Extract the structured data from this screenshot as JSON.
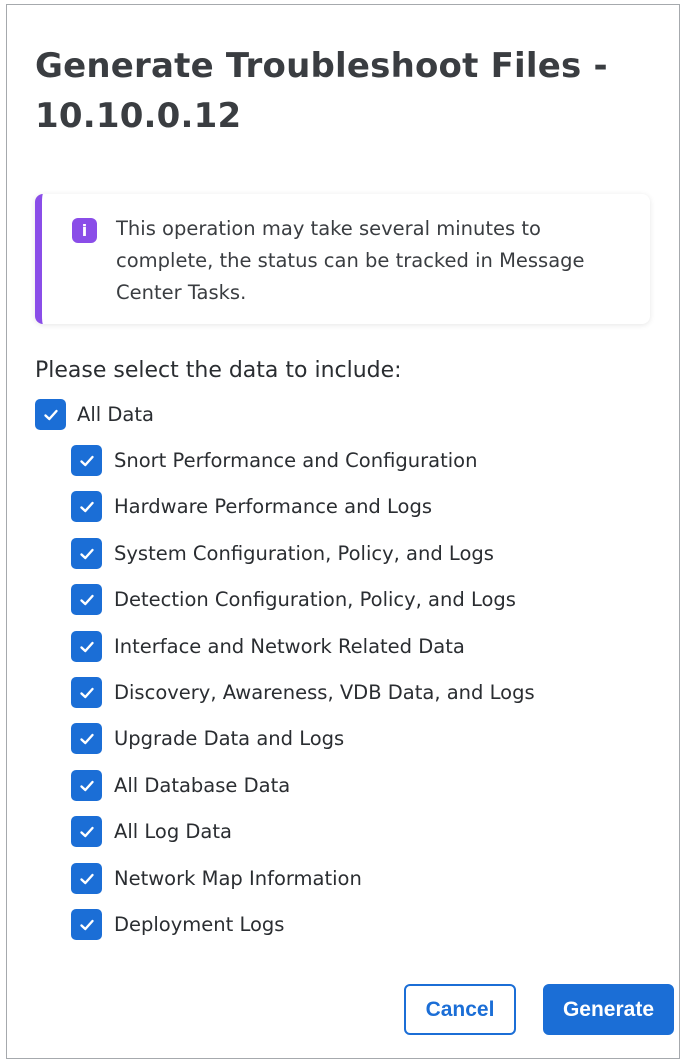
{
  "dialog": {
    "title": "Generate Troubleshoot Files - 10.10.0.12",
    "notice": {
      "icon": "info-icon",
      "icon_glyph": "i",
      "text": "This operation may take several minutes to complete, the status can be tracked in Message Center Tasks.",
      "accent_color": "#8a4de8"
    },
    "prompt": "Please select the data to include:",
    "all_data": {
      "label": "All Data",
      "checked": true
    },
    "options": [
      {
        "label": "Snort Performance and Configuration",
        "checked": true
      },
      {
        "label": "Hardware Performance and Logs",
        "checked": true
      },
      {
        "label": "System Configuration, Policy, and Logs",
        "checked": true
      },
      {
        "label": "Detection Configuration, Policy, and Logs",
        "checked": true
      },
      {
        "label": "Interface and Network Related Data",
        "checked": true
      },
      {
        "label": "Discovery, Awareness, VDB Data, and Logs",
        "checked": true
      },
      {
        "label": "Upgrade Data and Logs",
        "checked": true
      },
      {
        "label": "All Database Data",
        "checked": true
      },
      {
        "label": "All Log Data",
        "checked": true
      },
      {
        "label": "Network Map Information",
        "checked": true
      },
      {
        "label": "Deployment Logs",
        "checked": true
      }
    ],
    "buttons": {
      "cancel": "Cancel",
      "generate": "Generate"
    },
    "colors": {
      "primary": "#1b6ed6",
      "border": "#a6a9ad"
    }
  }
}
